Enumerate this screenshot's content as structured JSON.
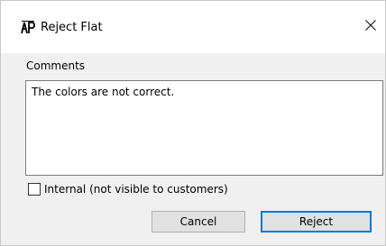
{
  "window": {
    "title": "Reject Flat",
    "app_icon_text": "AP"
  },
  "form": {
    "comments_label": "Comments",
    "comments_value": "The colors are not correct.",
    "internal_checkbox_label": "Internal (not visible to customers)",
    "internal_checked": false
  },
  "buttons": {
    "cancel_label": "Cancel",
    "reject_label": "Reject"
  },
  "colors": {
    "accent": "#0078d7",
    "dialog_bg": "#f0f0f0"
  },
  "icons": {
    "app": "ap-logo-icon",
    "close": "close-icon"
  }
}
